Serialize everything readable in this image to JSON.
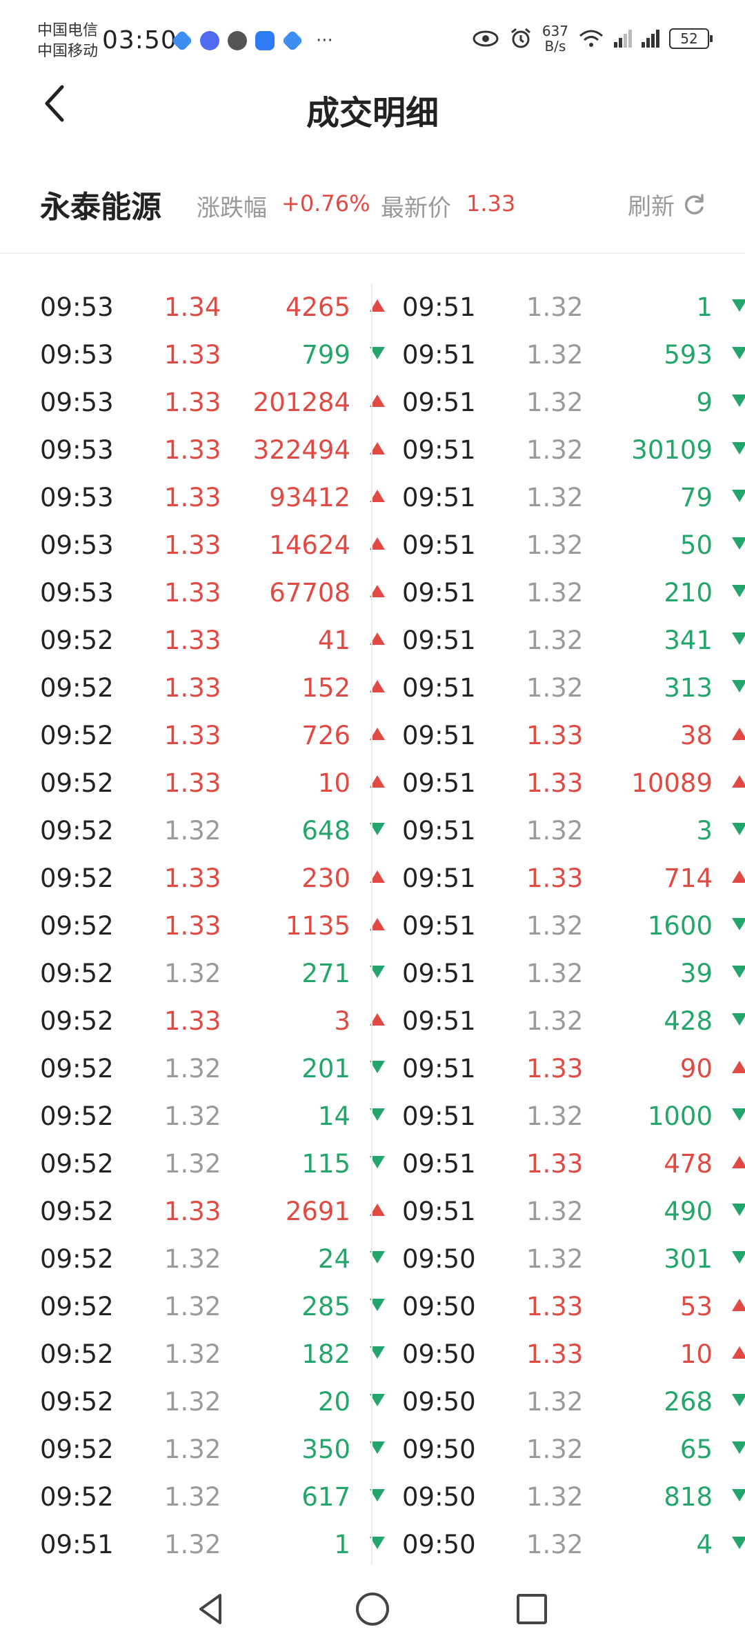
{
  "status": {
    "carrier1": "中国电信",
    "carrier2": "中国移动",
    "time": "03:50",
    "speed_value": "637",
    "speed_unit": "B/s",
    "battery": "52",
    "more": "···"
  },
  "header": {
    "title": "成交明细"
  },
  "info": {
    "stock_name": "永泰能源",
    "change_label": "涨跌幅",
    "change_value": "+0.76%",
    "price_label": "最新价",
    "price_value": "1.33",
    "refresh_label": "刷新"
  },
  "colors": {
    "up": "#e04a43",
    "down": "#24a56b",
    "neutral": "#9a9a9a"
  },
  "trades_left": [
    {
      "time": "09:53",
      "price": "1.34",
      "vol": "4265",
      "dir": "up"
    },
    {
      "time": "09:53",
      "price": "1.33",
      "vol": "799",
      "dir": "down"
    },
    {
      "time": "09:53",
      "price": "1.33",
      "vol": "201284",
      "dir": "up"
    },
    {
      "time": "09:53",
      "price": "1.33",
      "vol": "322494",
      "dir": "up"
    },
    {
      "time": "09:53",
      "price": "1.33",
      "vol": "93412",
      "dir": "up"
    },
    {
      "time": "09:53",
      "price": "1.33",
      "vol": "14624",
      "dir": "up"
    },
    {
      "time": "09:53",
      "price": "1.33",
      "vol": "67708",
      "dir": "up"
    },
    {
      "time": "09:52",
      "price": "1.33",
      "vol": "41",
      "dir": "up"
    },
    {
      "time": "09:52",
      "price": "1.33",
      "vol": "152",
      "dir": "up"
    },
    {
      "time": "09:52",
      "price": "1.33",
      "vol": "726",
      "dir": "up"
    },
    {
      "time": "09:52",
      "price": "1.33",
      "vol": "10",
      "dir": "up"
    },
    {
      "time": "09:52",
      "price": "1.32",
      "vol": "648",
      "dir": "down"
    },
    {
      "time": "09:52",
      "price": "1.33",
      "vol": "230",
      "dir": "up"
    },
    {
      "time": "09:52",
      "price": "1.33",
      "vol": "1135",
      "dir": "up"
    },
    {
      "time": "09:52",
      "price": "1.32",
      "vol": "271",
      "dir": "down"
    },
    {
      "time": "09:52",
      "price": "1.33",
      "vol": "3",
      "dir": "up"
    },
    {
      "time": "09:52",
      "price": "1.32",
      "vol": "201",
      "dir": "down"
    },
    {
      "time": "09:52",
      "price": "1.32",
      "vol": "14",
      "dir": "down"
    },
    {
      "time": "09:52",
      "price": "1.32",
      "vol": "115",
      "dir": "down"
    },
    {
      "time": "09:52",
      "price": "1.33",
      "vol": "2691",
      "dir": "up"
    },
    {
      "time": "09:52",
      "price": "1.32",
      "vol": "24",
      "dir": "down"
    },
    {
      "time": "09:52",
      "price": "1.32",
      "vol": "285",
      "dir": "down"
    },
    {
      "time": "09:52",
      "price": "1.32",
      "vol": "182",
      "dir": "down"
    },
    {
      "time": "09:52",
      "price": "1.32",
      "vol": "20",
      "dir": "down"
    },
    {
      "time": "09:52",
      "price": "1.32",
      "vol": "350",
      "dir": "down"
    },
    {
      "time": "09:52",
      "price": "1.32",
      "vol": "617",
      "dir": "down"
    },
    {
      "time": "09:51",
      "price": "1.32",
      "vol": "1",
      "dir": "down"
    }
  ],
  "trades_right": [
    {
      "time": "09:51",
      "price": "1.32",
      "vol": "1",
      "dir": "down"
    },
    {
      "time": "09:51",
      "price": "1.32",
      "vol": "593",
      "dir": "down"
    },
    {
      "time": "09:51",
      "price": "1.32",
      "vol": "9",
      "dir": "down"
    },
    {
      "time": "09:51",
      "price": "1.32",
      "vol": "30109",
      "dir": "down"
    },
    {
      "time": "09:51",
      "price": "1.32",
      "vol": "79",
      "dir": "down"
    },
    {
      "time": "09:51",
      "price": "1.32",
      "vol": "50",
      "dir": "down"
    },
    {
      "time": "09:51",
      "price": "1.32",
      "vol": "210",
      "dir": "down"
    },
    {
      "time": "09:51",
      "price": "1.32",
      "vol": "341",
      "dir": "down"
    },
    {
      "time": "09:51",
      "price": "1.32",
      "vol": "313",
      "dir": "down"
    },
    {
      "time": "09:51",
      "price": "1.33",
      "vol": "38",
      "dir": "up"
    },
    {
      "time": "09:51",
      "price": "1.33",
      "vol": "10089",
      "dir": "up"
    },
    {
      "time": "09:51",
      "price": "1.32",
      "vol": "3",
      "dir": "down"
    },
    {
      "time": "09:51",
      "price": "1.33",
      "vol": "714",
      "dir": "up"
    },
    {
      "time": "09:51",
      "price": "1.32",
      "vol": "1600",
      "dir": "down"
    },
    {
      "time": "09:51",
      "price": "1.32",
      "vol": "39",
      "dir": "down"
    },
    {
      "time": "09:51",
      "price": "1.32",
      "vol": "428",
      "dir": "down"
    },
    {
      "time": "09:51",
      "price": "1.33",
      "vol": "90",
      "dir": "up"
    },
    {
      "time": "09:51",
      "price": "1.32",
      "vol": "1000",
      "dir": "down"
    },
    {
      "time": "09:51",
      "price": "1.33",
      "vol": "478",
      "dir": "up"
    },
    {
      "time": "09:51",
      "price": "1.32",
      "vol": "490",
      "dir": "down"
    },
    {
      "time": "09:50",
      "price": "1.32",
      "vol": "301",
      "dir": "down"
    },
    {
      "time": "09:50",
      "price": "1.33",
      "vol": "53",
      "dir": "up"
    },
    {
      "time": "09:50",
      "price": "1.33",
      "vol": "10",
      "dir": "up"
    },
    {
      "time": "09:50",
      "price": "1.32",
      "vol": "268",
      "dir": "down"
    },
    {
      "time": "09:50",
      "price": "1.32",
      "vol": "65",
      "dir": "down"
    },
    {
      "time": "09:50",
      "price": "1.32",
      "vol": "818",
      "dir": "down"
    },
    {
      "time": "09:50",
      "price": "1.32",
      "vol": "4",
      "dir": "down"
    }
  ],
  "icons": {
    "back": "chevron-left-icon",
    "refresh": "refresh-icon",
    "nav_back": "triangle-back-icon",
    "nav_home": "circle-home-icon",
    "nav_recents": "square-recents-icon"
  }
}
